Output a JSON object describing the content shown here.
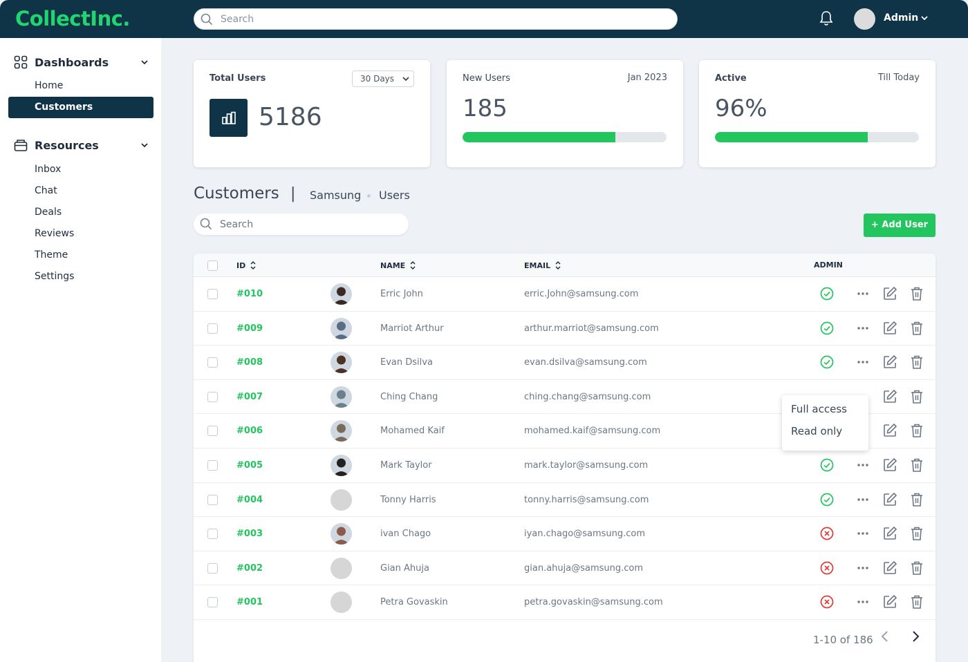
{
  "app": {
    "logo": "CollectInc.",
    "search_placeholder": "Search",
    "user_name": "Admin"
  },
  "sidebar": {
    "groups": [
      {
        "label": "Dashboards",
        "icon": "grid-icon",
        "items": [
          "Home",
          "Customers"
        ]
      },
      {
        "label": "Resources",
        "icon": "briefcase-icon",
        "items": [
          "Inbox",
          "Chat",
          "Deals",
          "Reviews",
          "Theme",
          "Settings"
        ]
      }
    ],
    "active_item": "Customers"
  },
  "stats": {
    "total_users": {
      "title": "Total Users",
      "range": "30 Days",
      "value": "5186",
      "icon": "bar-chart-icon"
    },
    "new_users": {
      "title": "New Users",
      "meta": "Jan 2023",
      "value": "185",
      "progress_pct": 75
    },
    "active": {
      "title": "Active",
      "meta": "Till Today",
      "value": "96%",
      "progress_pct": 75
    }
  },
  "section": {
    "title": "Customers",
    "separator": "|",
    "breadcrumb": [
      "Samsung",
      "Users"
    ],
    "search_placeholder": "Search",
    "add_button": "+ Add User"
  },
  "table": {
    "columns": [
      "ID",
      "NAME",
      "EMAIL",
      "ADMIN"
    ],
    "rows": [
      {
        "id": "#010",
        "name": "Erric John",
        "email": "erric.John@samsung.com",
        "admin": true,
        "avatar": "photo"
      },
      {
        "id": "#009",
        "name": "Marriot Arthur",
        "email": "arthur.marriot@samsung.com",
        "admin": true,
        "avatar": "photo"
      },
      {
        "id": "#008",
        "name": "Evan Dsilva",
        "email": "evan.dsilva@samsung.com",
        "admin": true,
        "avatar": "photo"
      },
      {
        "id": "#007",
        "name": "Ching Chang",
        "email": "ching.chang@samsung.com",
        "admin": true,
        "avatar": "photo"
      },
      {
        "id": "#006",
        "name": "Mohamed Kaif",
        "email": "mohamed.kaif@samsung.com",
        "admin": true,
        "avatar": "photo"
      },
      {
        "id": "#005",
        "name": "Mark Taylor",
        "email": "mark.taylor@samsung.com",
        "admin": true,
        "avatar": "photo"
      },
      {
        "id": "#004",
        "name": "Tonny Harris",
        "email": "tonny.harris@samsung.com",
        "admin": true,
        "avatar": "placeholder"
      },
      {
        "id": "#003",
        "name": "ivan Chago",
        "email": "iyan.chago@samsung.com",
        "admin": false,
        "avatar": "photo"
      },
      {
        "id": "#002",
        "name": "Gian Ahuja",
        "email": "gian.ahuja@samsung.com",
        "admin": false,
        "avatar": "placeholder"
      },
      {
        "id": "#001",
        "name": "Petra Govaskin",
        "email": "petra.govaskin@samsung.com",
        "admin": false,
        "avatar": "placeholder"
      }
    ],
    "pagination": "1-10 of 186"
  },
  "popover": {
    "options": [
      "Full access",
      "Read only"
    ]
  },
  "colors": {
    "brand_dark": "#0f3447",
    "accent_green": "#22c55e",
    "error_red": "#e53935"
  }
}
